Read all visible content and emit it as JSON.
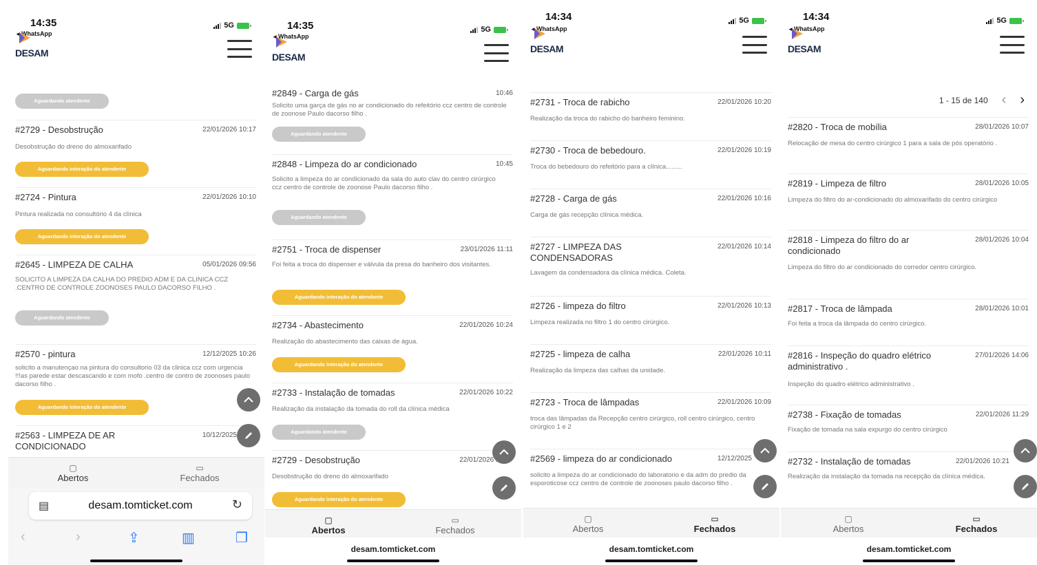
{
  "common": {
    "back_app": "◂ WhatsApp",
    "network": "5G",
    "brand": "DESAM",
    "tabs": {
      "open": "Abertos",
      "closed": "Fechados"
    },
    "url": "desam.tomticket.com",
    "status_waiting": "Aguardando atendente",
    "status_waiting_interaction": "Aguardando interação do atendente",
    "colors": {
      "pill_yellow": "#f2bd36",
      "pill_gray": "#c9c9c9",
      "fab": "#6e6e6e",
      "ios_blue": "#2b7cf6"
    }
  },
  "p1": {
    "time": "14:35",
    "items": [
      {
        "title": "#2729 - Desobstrução",
        "date": "22/01/2026 10:17",
        "desc": "Desobstrução do dreno do almoxarifado"
      },
      {
        "title": "#2724 - Pintura",
        "date": "22/01/2026 10:10",
        "desc": "Pintura realizada no consultório 4 da clínica"
      },
      {
        "title": "#2645 - LIMPEZA DE CALHA",
        "date": "05/01/2026 09:56",
        "desc": "SOLICITO A LIMPEZA DA CALHA DO PREDIO ADM E DA CLINICA CCZ .CENTRO DE CONTROLE ZOONOSES PAULO DACORSO FILHO ."
      },
      {
        "title": "#2570 - pintura",
        "date": "12/12/2025 10:26",
        "desc": "solicito a manutençao na pintura do consultorio 03 da clinica ccz com urgencia !!!as parede estar descascando e com mofo .centro de contro de zoonoses paulo dacorso filho ."
      },
      {
        "title": "#2563 - LIMPEZA DE AR CONDICIONADO",
        "date": "10/12/2025"
      }
    ]
  },
  "p2": {
    "time": "14:35",
    "items": [
      {
        "title": "#2849 - Carga de gás",
        "date": "10:46",
        "desc": "Solicito uma garça de gás no ar condicionado do refeitório ccz centro de controle de zoonose Paulo dacorso filho ."
      },
      {
        "title": "#2848 - Limpeza do ar condicionado",
        "date": "10:45",
        "desc": "Solicito a limpeza do ar condicionado da sala do auto clav do centro cirúrgico ccz centro de controle de zoonose Paulo dacorso filho ."
      },
      {
        "title": "#2751 - Troca de dispenser",
        "date": "23/01/2026 11:11",
        "desc": "Foi feita a troca do dispenser e válvula da presa do banheiro dos visitantes."
      },
      {
        "title": "#2734 - Abastecimento",
        "date": "22/01/2026 10:24",
        "desc": "Realização do abastecimento das caixas de água."
      },
      {
        "title": "#2733 - Instalação de tomadas",
        "date": "22/01/2026 10:22",
        "desc": "Realização da instalação da tomada do roll da clínica médica"
      },
      {
        "title": "#2729 - Desobstrução",
        "date": "22/01/2026 10:17",
        "desc": "Desobstrução do dreno do almoxarifado"
      }
    ]
  },
  "p3": {
    "time": "14:34",
    "items": [
      {
        "title": "#2731 - Troca de rabicho",
        "date": "22/01/2026 10:20",
        "desc": "Realização da troca do rabicho do banheiro feminino."
      },
      {
        "title": "#2730 - Troca de bebedouro.",
        "date": "22/01/2026 10:19",
        "desc": "Troca do bebedouro do refeitório para a clínica........."
      },
      {
        "title": "#2728 - Carga de gás",
        "date": "22/01/2026 10:16",
        "desc": "Carga de gás recepção clínica médica."
      },
      {
        "title": "#2727 - LIMPEZA DAS CONDENSADORAS",
        "date": "22/01/2026 10:14",
        "desc": "Lavagem da condensadora da clínica médica. Coleta."
      },
      {
        "title": "#2726 - limpeza do filtro",
        "date": "22/01/2026 10:13",
        "desc": "Limpeza realizada no filtro 1 do centro cirúrgico."
      },
      {
        "title": "#2725 - limpeza de calha",
        "date": "22/01/2026 10:11",
        "desc": "Realização da limpeza das calhas da unidade."
      },
      {
        "title": "#2723 - Troca de lâmpadas",
        "date": "22/01/2026 10:09",
        "desc": "troca das lâmpadas da Recepção centro cirúrgico, roll centro cirúrgico, centro cirúrgico 1 e 2"
      },
      {
        "title": "#2569 - limpeza do ar condicionado",
        "date": "12/12/2025",
        "desc": "solicito a limpeza do ar condicionado do laboratorio e da adm do predio da esporoticose ccz centro de controle de zoonoses paulo dacorso filho ."
      }
    ]
  },
  "p4": {
    "time": "14:34",
    "pager": "1 - 15 de 140",
    "items": [
      {
        "title": "#2820 - Troca de mobília",
        "date": "28/01/2026 10:07",
        "desc": "Relocação de mesa do centro cirúrgico 1 para a sala de pós operatório ."
      },
      {
        "title": "#2819 - Limpeza de filtro",
        "date": "28/01/2026 10:05",
        "desc": "Limpeza do filtro do ar-condicionado do almoxarifado do centro cirúrgico"
      },
      {
        "title": "#2818 - Limpeza do filtro do ar condicionado",
        "date": "28/01/2026 10:04",
        "desc": "Limpeza do filtro do ar condicionado do corredor centro cirúrgico."
      },
      {
        "title": "#2817 - Troca de lâmpada",
        "date": "28/01/2026 10:01",
        "desc": "Foi feita a troca da lâmpada do centro cirúrgico."
      },
      {
        "title": "#2816 - Inspeção do quadro elétrico administrativo .",
        "date": "27/01/2026 14:06",
        "desc": "Inspeção do quadro elétrico administrativo ."
      },
      {
        "title": "#2738 - Fixação de tomadas",
        "date": "22/01/2026 11:29",
        "desc": "Fixação de tomada na sala expurgo do centro cirúrgico"
      },
      {
        "title": "#2732 - Instalação de tomadas",
        "date": "22/01/2026 10:21",
        "desc": "Realização da instalação da tomada na recepção da clínica médica."
      }
    ]
  }
}
